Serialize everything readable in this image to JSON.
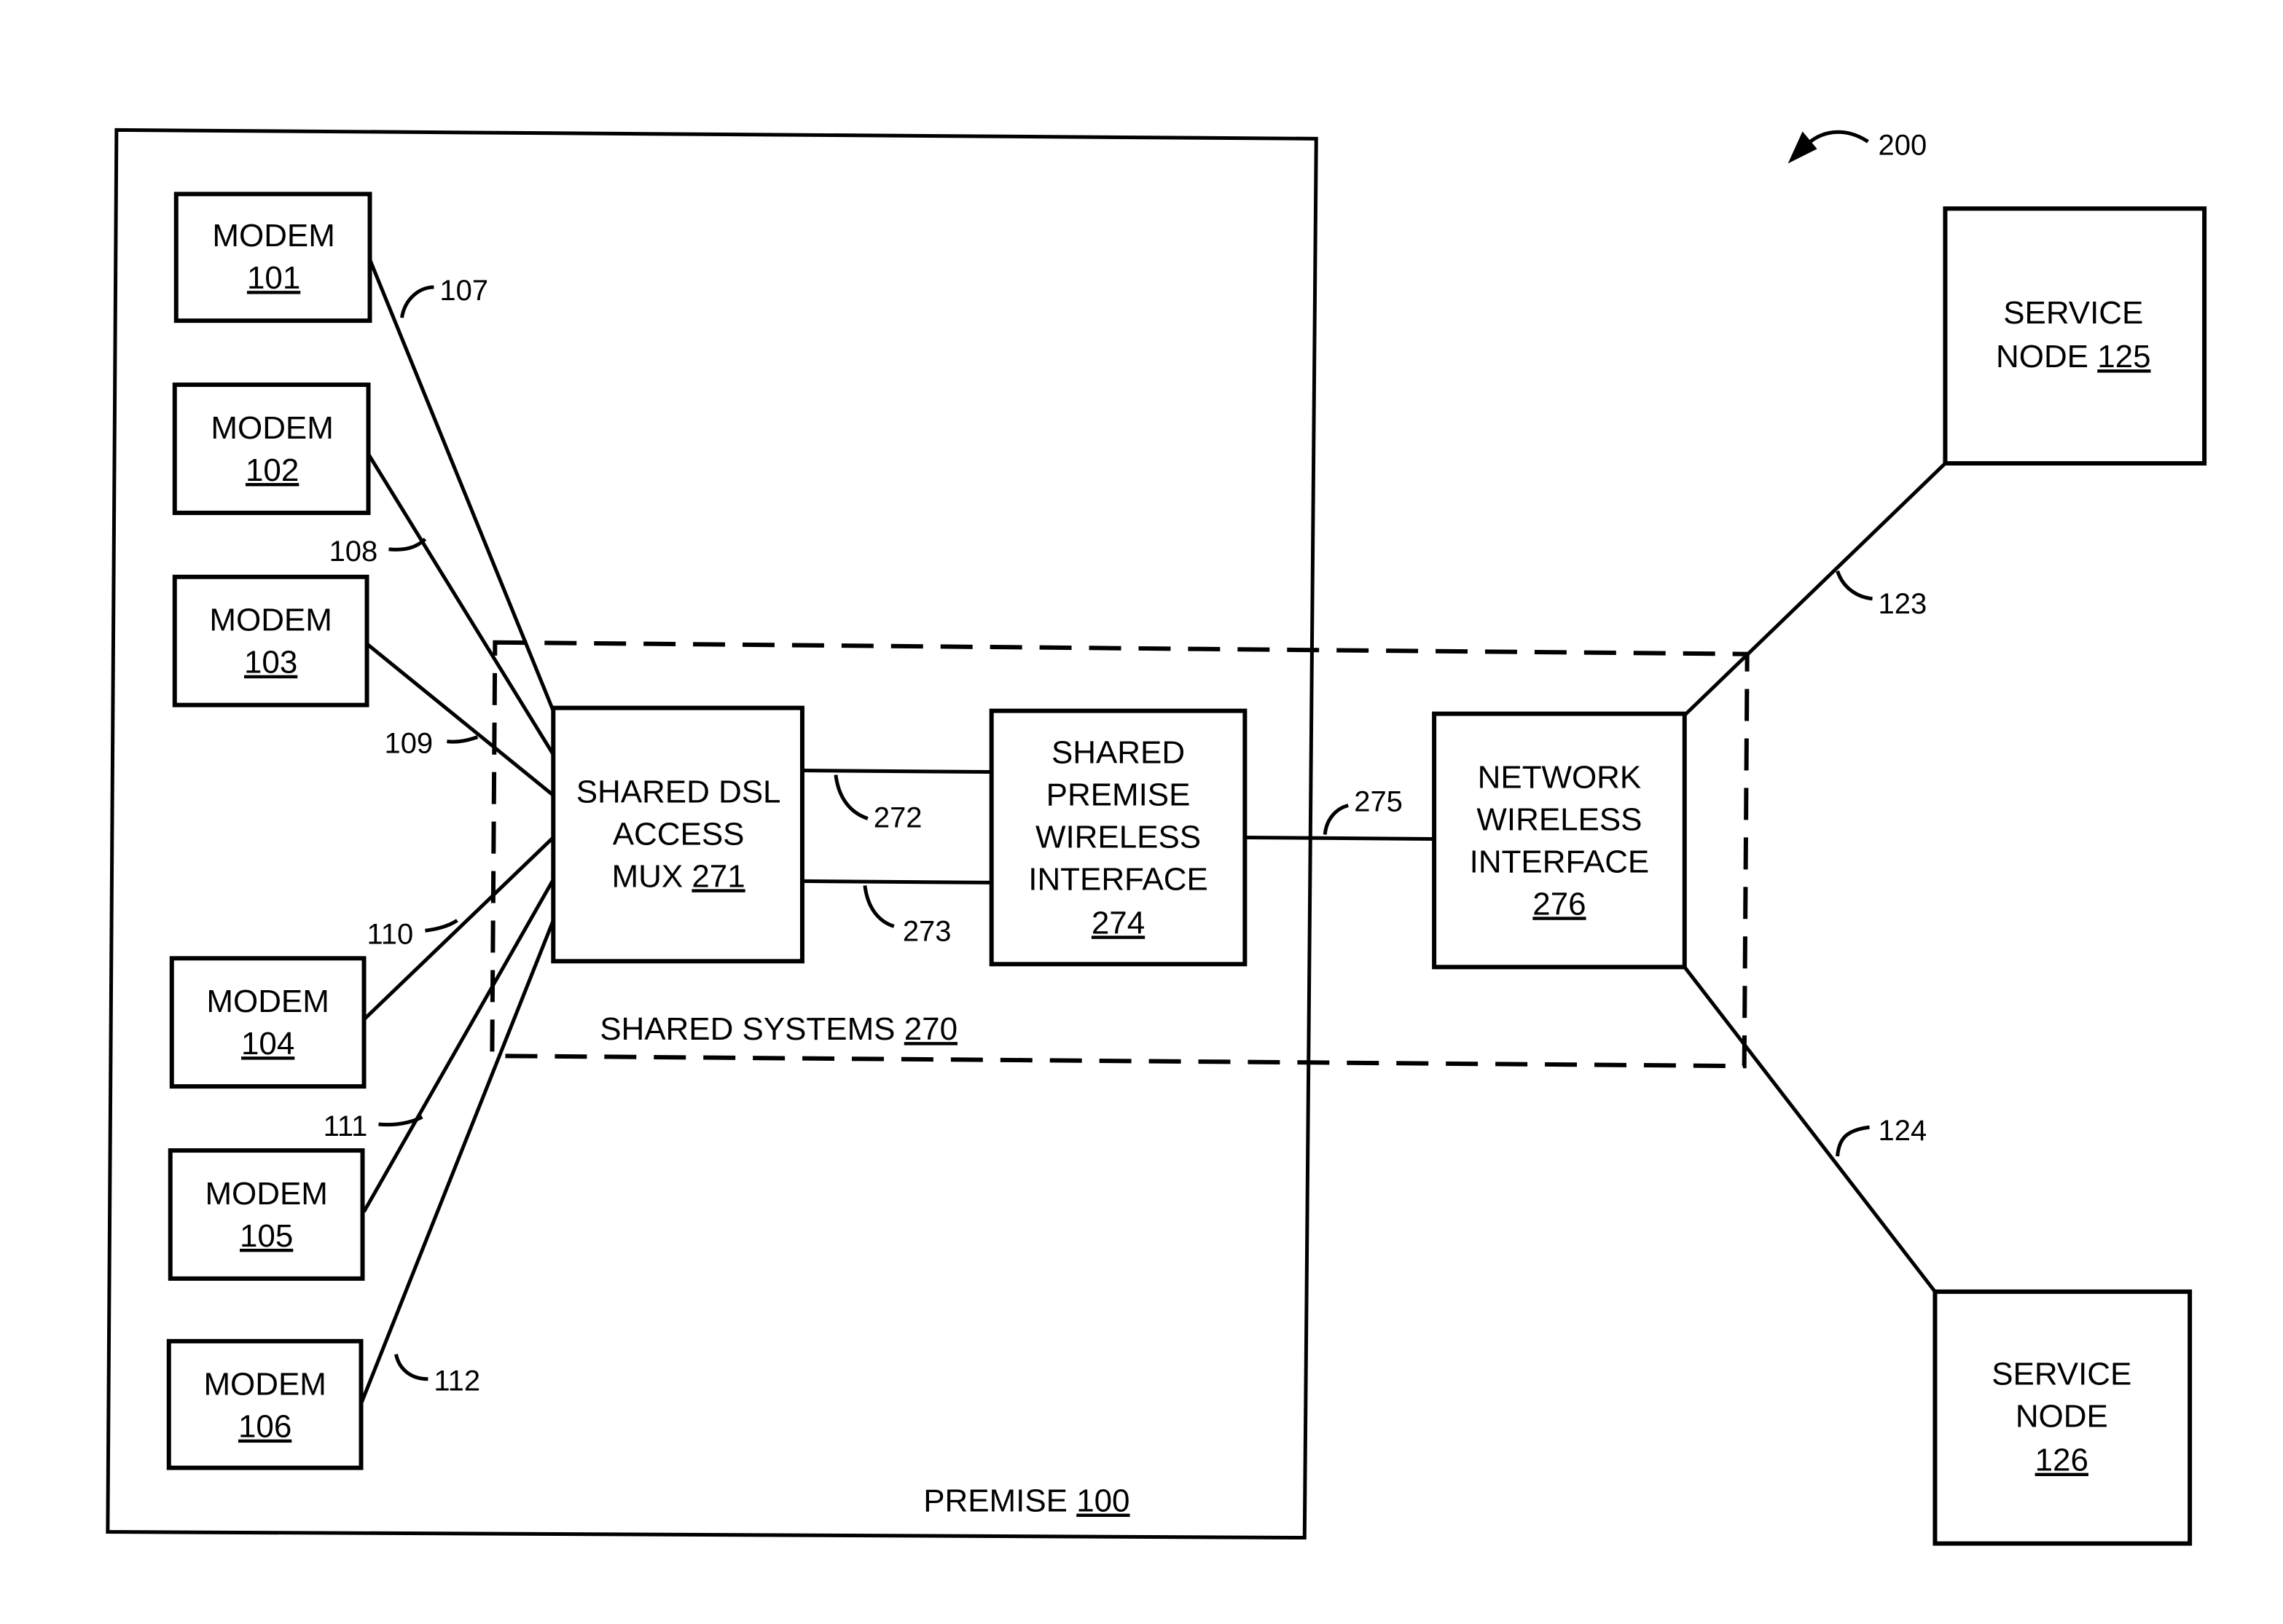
{
  "figure_ref": "200",
  "premise": {
    "label": "PREMISE",
    "ref": "100"
  },
  "shared_systems": {
    "label": "SHARED SYSTEMS",
    "ref": "270"
  },
  "modems": [
    {
      "label": "MODEM",
      "ref": "101",
      "line_ref": "107"
    },
    {
      "label": "MODEM",
      "ref": "102",
      "line_ref": "108"
    },
    {
      "label": "MODEM",
      "ref": "103",
      "line_ref": "109"
    },
    {
      "label": "MODEM",
      "ref": "104",
      "line_ref": "110"
    },
    {
      "label": "MODEM",
      "ref": "105",
      "line_ref": "111"
    },
    {
      "label": "MODEM",
      "ref": "106",
      "line_ref": "112"
    }
  ],
  "dslam": {
    "lines": [
      "SHARED DSL",
      "ACCESS",
      "MUX"
    ],
    "ref": "271"
  },
  "links": {
    "upper": "272",
    "lower": "273",
    "wireless": "275",
    "to_node_125": "123",
    "to_node_126": "124"
  },
  "premise_wireless": {
    "lines": [
      "SHARED",
      "PREMISE",
      "WIRELESS",
      "INTERFACE"
    ],
    "ref": "274"
  },
  "network_wireless": {
    "lines": [
      "NETWORK",
      "WIRELESS",
      "INTERFACE"
    ],
    "ref": "276"
  },
  "service_node_125": {
    "lines": [
      "SERVICE",
      "NODE"
    ],
    "ref": "125"
  },
  "service_node_126": {
    "lines": [
      "SERVICE",
      "NODE"
    ],
    "ref": "126"
  }
}
